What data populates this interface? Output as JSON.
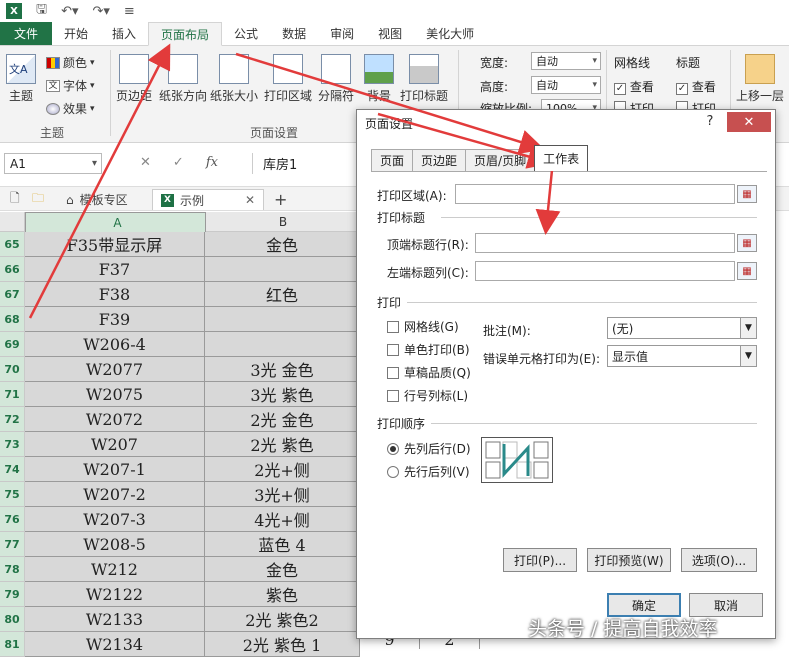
{
  "app": {
    "logo_text": "X"
  },
  "tabs": [
    "文件",
    "开始",
    "插入",
    "页面布局",
    "公式",
    "数据",
    "审阅",
    "视图",
    "美化大师"
  ],
  "ribbon": {
    "theme_label": "主题",
    "colors_label": "颜色",
    "fonts_label": "字体",
    "effects_label": "效果",
    "group_theme": "主题",
    "margins": "页边距",
    "orientation": "纸张方向",
    "size": "纸张大小",
    "print_area": "打印区域",
    "breaks": "分隔符",
    "background": "背景",
    "print_titles": "打印标题",
    "group_page_setup": "页面设置",
    "width_label": "宽度:",
    "height_label": "高度:",
    "scale_label": "缩放比例:",
    "width_value": "自动",
    "height_value": "自动",
    "scale_value": "100%",
    "gridlines_group": "网格线",
    "headings_group": "标题",
    "view_label": "查看",
    "print_label": "打印",
    "bring_forward": "上移一层"
  },
  "formula_bar": {
    "name_box": "A1",
    "fx": "fx",
    "content": "库房1"
  },
  "sheet_tabs": {
    "template_zone": "模板专区",
    "example": "示例",
    "add": "+"
  },
  "columns": [
    "A",
    "B"
  ],
  "rows": [
    {
      "n": "65",
      "a": "F35带显示屏",
      "b": "金色"
    },
    {
      "n": "66",
      "a": "F37",
      "b": ""
    },
    {
      "n": "67",
      "a": "F38",
      "b": "红色"
    },
    {
      "n": "68",
      "a": "F39",
      "b": ""
    },
    {
      "n": "69",
      "a": "W206-4",
      "b": ""
    },
    {
      "n": "70",
      "a": "W2077",
      "b": "3光 金色"
    },
    {
      "n": "71",
      "a": "W2075",
      "b": "3光 紫色"
    },
    {
      "n": "72",
      "a": "W2072",
      "b": "2光 金色"
    },
    {
      "n": "73",
      "a": "W207",
      "b": "2光 紫色"
    },
    {
      "n": "74",
      "a": "W207-1",
      "b": "2光+侧"
    },
    {
      "n": "75",
      "a": "W207-2",
      "b": "3光+侧"
    },
    {
      "n": "76",
      "a": "W207-3",
      "b": "4光+侧"
    },
    {
      "n": "77",
      "a": "W208-5",
      "b": "蓝色 4"
    },
    {
      "n": "78",
      "a": "W212",
      "b": "金色"
    },
    {
      "n": "79",
      "a": "W2122",
      "b": "紫色"
    },
    {
      "n": "80",
      "a": "W2133",
      "b": "2光 紫色2"
    },
    {
      "n": "81",
      "a": "W2134",
      "b": "2光 紫色 1"
    }
  ],
  "behind_values": [
    "9",
    "2"
  ],
  "dialog": {
    "title": "页面设置",
    "help": "?",
    "close": "✕",
    "tabs": [
      "页面",
      "页边距",
      "页眉/页脚",
      "工作表"
    ],
    "print_area": "打印区域(A):",
    "print_titles": "打印标题",
    "rows_repeat": "顶端标题行(R):",
    "cols_repeat": "左端标题列(C):",
    "print_section": "打印",
    "gridlines": "网格线(G)",
    "mono": "单色打印(B)",
    "draft": "草稿品质(Q)",
    "row_col_headings": "行号列标(L)",
    "comments_label": "批注(M):",
    "comments_value": "(无)",
    "errors_label": "错误单元格打印为(E):",
    "errors_value": "显示值",
    "order_section": "打印顺序",
    "down_then_over": "先列后行(D)",
    "over_then_down": "先行后列(V)",
    "btn_print": "打印(P)...",
    "btn_preview": "打印预览(W)",
    "btn_options": "选项(O)...",
    "btn_ok": "确定",
    "btn_cancel": "取消"
  },
  "watermark": "头条号 / 提高自我效率",
  "colors": {
    "excel_green": "#217346",
    "arrow_red": "#e23b3b",
    "row_header_green": "#d3e7d9"
  }
}
